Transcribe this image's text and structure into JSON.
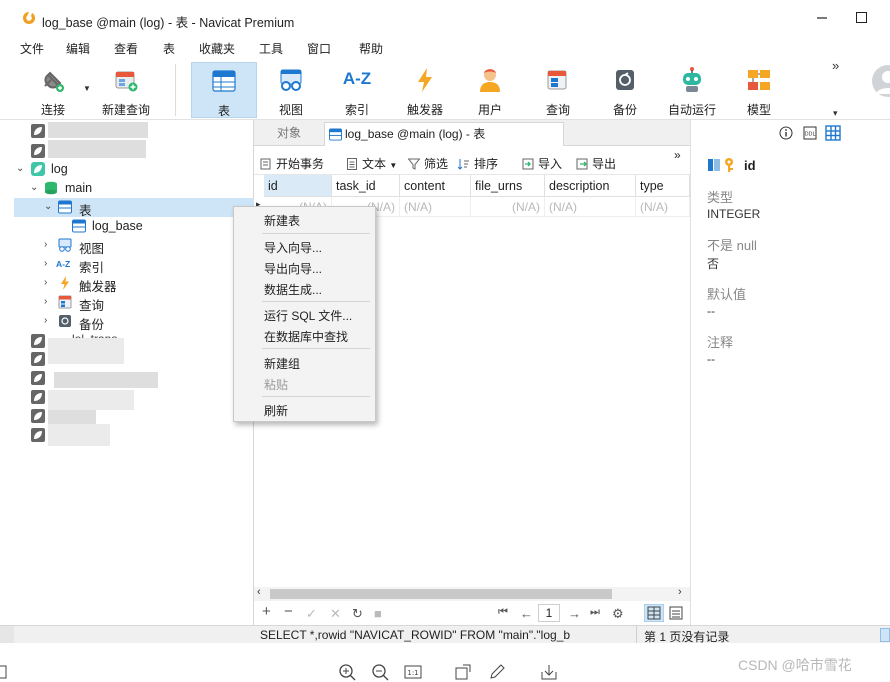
{
  "window": {
    "title": "log_base @main (log) - 表 - Navicat Premium"
  },
  "menu": [
    "文件",
    "编辑",
    "查看",
    "表",
    "收藏夹",
    "工具",
    "窗口",
    "帮助"
  ],
  "toolbar": {
    "connect": "连接",
    "new_query": "新建查询",
    "table": "表",
    "view": "视图",
    "index": "索引",
    "index_glyph": "A-Z",
    "trigger": "触发器",
    "user": "用户",
    "query": "查询",
    "backup": "备份",
    "automation": "自动运行",
    "model": "模型",
    "more": "»",
    "more_down": "▾"
  },
  "tree": {
    "db": "log",
    "schema": "main",
    "tables_folder": "表",
    "table": "log_base",
    "views": "视图",
    "indexes": "索引",
    "indexes_glyph": "A-Z",
    "triggers": "触发器",
    "queries": "查询",
    "backups": "备份",
    "obscured_item": "lol_trans"
  },
  "tabs": {
    "objects": "对象",
    "active": "log_base @main (log) - 表"
  },
  "subtoolbar": {
    "begin_tx": "开始事务",
    "text": "文本",
    "filter": "筛选",
    "sort": "排序",
    "import": "导入",
    "export": "导出",
    "more": "»"
  },
  "grid": {
    "columns": [
      "id",
      "task_id",
      "content",
      "file_urns",
      "description",
      "type"
    ],
    "null_value": "(N/A)"
  },
  "gridnav": {
    "page": "1"
  },
  "info": {
    "field_name": "id",
    "type_label": "类型",
    "type_value": "INTEGER",
    "notnull_label": "不是 null",
    "notnull_value": "否",
    "default_label": "默认值",
    "default_value": "--",
    "comment_label": "注释",
    "comment_value": "--"
  },
  "status": {
    "sql": "SELECT *,rowid \"NAVICAT_ROWID\" FROM \"main\".\"log_b",
    "page_info": "第 1 页没有记录"
  },
  "context_menu": {
    "new_table": "新建表",
    "import_wizard": "导入向导...",
    "export_wizard": "导出向导...",
    "data_gen": "数据生成...",
    "run_sql": "运行 SQL 文件...",
    "find_in_db": "在数据库中查找",
    "new_group": "新建组",
    "paste": "粘贴",
    "refresh": "刷新"
  },
  "watermark": "CSDN @哈市雪花",
  "colors": {
    "accent": "#1e78d0",
    "selection": "#cde5f7",
    "trigger": "#f5a623",
    "db_green": "#2eb86e"
  }
}
